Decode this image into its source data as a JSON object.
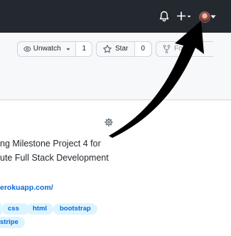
{
  "header": {
    "icons": [
      "bell-icon",
      "plus-icon",
      "caret-down-icon",
      "avatar",
      "caret-down-icon"
    ]
  },
  "actions": {
    "watch_label": "Unwatch",
    "watch_count": "1",
    "star_label": "Star",
    "star_count": "0",
    "fork_label": "Fo"
  },
  "about": {
    "description_line1": "ng Milestone Project 4 for",
    "description_line2": "ute Full Stack Development",
    "website": "erokuapp.com/",
    "topics": [
      "css",
      "html",
      "bootstrap",
      "stripe"
    ]
  },
  "annotation": {
    "arrow_color": "#000000"
  }
}
